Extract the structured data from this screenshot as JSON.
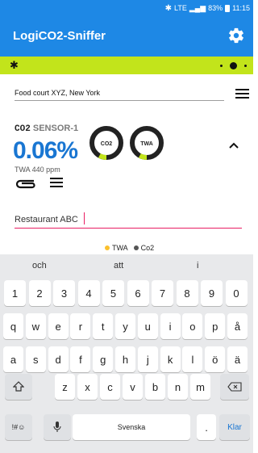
{
  "status_bar": {
    "battery": "83%",
    "time": "11:15",
    "network": "LTE"
  },
  "app": {
    "title": "LogiCO2-Sniffer"
  },
  "location": {
    "text": "Food court XYZ, New York"
  },
  "sensor": {
    "gas": "CO2",
    "name": "SENSOR-1",
    "reading": "0.06%",
    "twa_label": "TWA 440 ppm",
    "gauges": [
      {
        "label": "CO2",
        "fill_fraction": 0.08
      },
      {
        "label": "TWA",
        "fill_fraction": 0.08
      }
    ]
  },
  "note_input": {
    "value": "Restaurant ABC"
  },
  "legend": [
    {
      "label": "TWA",
      "color": "#fbc02d"
    },
    {
      "label": "Co2",
      "color": "#555555"
    }
  ],
  "keyboard": {
    "suggestions": [
      "och",
      "att",
      "i"
    ],
    "row1": [
      "1",
      "2",
      "3",
      "4",
      "5",
      "6",
      "7",
      "8",
      "9",
      "0"
    ],
    "row2": [
      "q",
      "w",
      "e",
      "r",
      "t",
      "y",
      "u",
      "i",
      "o",
      "p",
      "å"
    ],
    "row3": [
      "a",
      "s",
      "d",
      "f",
      "g",
      "h",
      "j",
      "k",
      "l",
      "ö",
      "ä"
    ],
    "row4": [
      "z",
      "x",
      "c",
      "v",
      "b",
      "n",
      "m"
    ],
    "symbols_label": "!#☺",
    "space_label": "Svenska",
    "period_label": ".",
    "enter_label": "Klar"
  },
  "colors": {
    "app_bar": "#1e88e5",
    "connection_bar": "#c2e41b",
    "reading": "#1976d2",
    "input_underline": "#e91e63"
  }
}
